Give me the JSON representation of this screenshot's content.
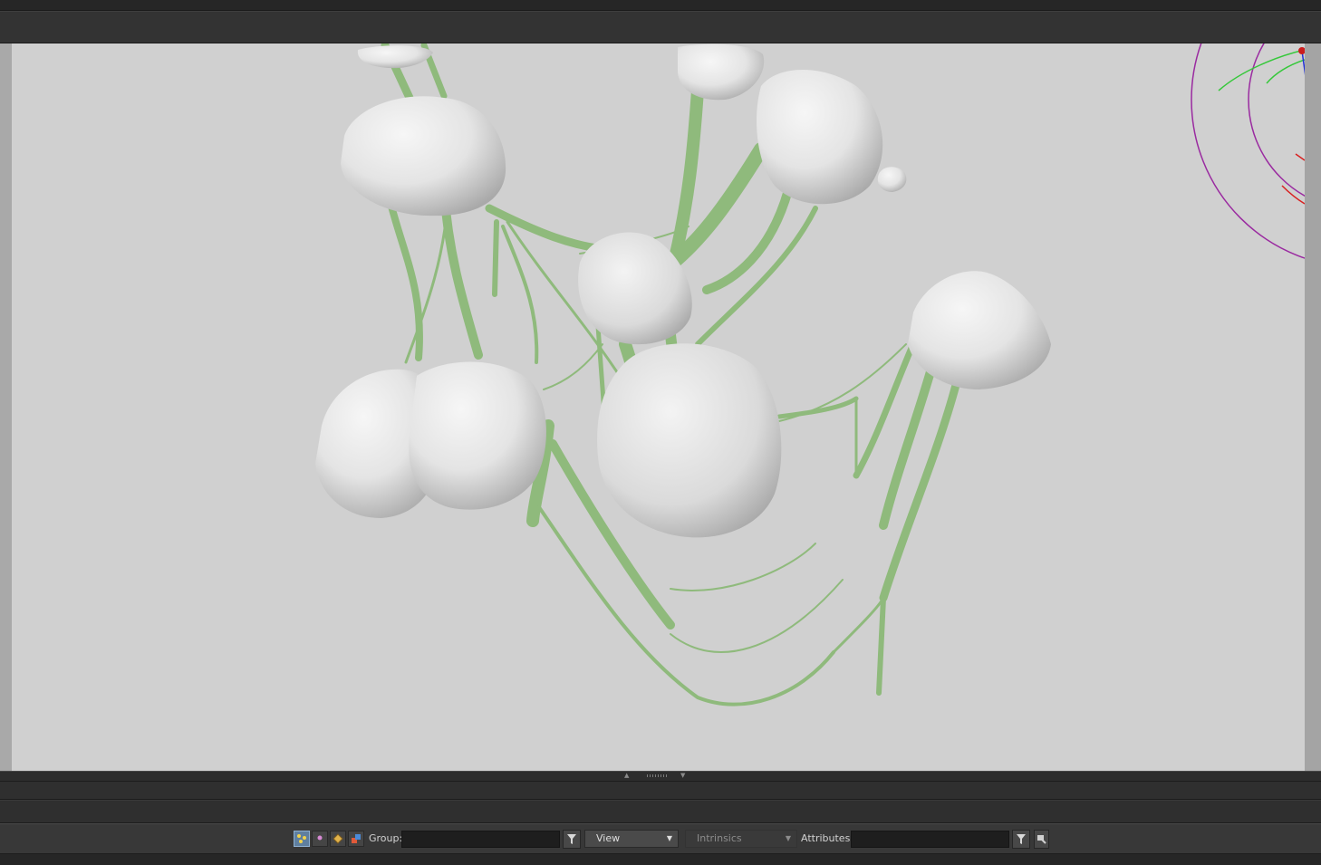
{
  "spreadsheet_toolbar": {
    "group_label": "Group:",
    "group_value": "",
    "view_label": "View",
    "intrinsics_label": "Intrinsics",
    "attributes_label": "Attributes:",
    "attributes_value": ""
  },
  "colors": {
    "viewport_background": "#d0d0d0",
    "web_green": "#8fba7c",
    "mesh_white": "#ededed",
    "panel_dark": "#2b2b2b"
  },
  "icons": [
    "points-mode-icon",
    "vertices-mode-icon",
    "primitives-mode-icon",
    "detail-mode-icon",
    "group-filter-icon",
    "attribute-filter-icon",
    "node-options-icon",
    "split-up-icon",
    "split-down-icon"
  ]
}
